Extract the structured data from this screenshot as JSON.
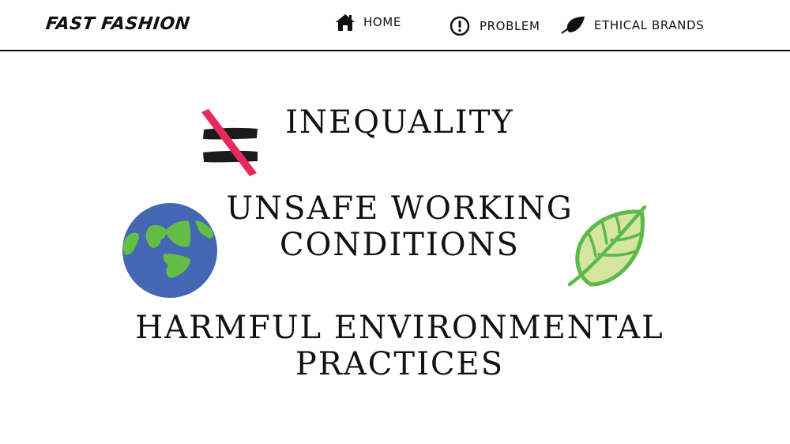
{
  "header": {
    "logo": "FAST FASHION",
    "nav": [
      {
        "label": "HOME",
        "icon": "home-icon"
      },
      {
        "label": "PROBLEM",
        "icon": "exclamation-circle-icon"
      },
      {
        "label": "ETHICAL BRANDS",
        "icon": "leaf-icon"
      }
    ]
  },
  "main": {
    "items": [
      {
        "lines": [
          "INEQUALITY"
        ]
      },
      {
        "lines": [
          "UNSAFE WORKING",
          "CONDITIONS"
        ]
      },
      {
        "lines": [
          "HARMFUL ENVIRONMENTAL",
          "PRACTICES"
        ]
      }
    ],
    "decor": {
      "not_equal_icon": "not-equal-icon",
      "globe_icon": "earth-globe-icon",
      "leaf_icon": "green-leaf-icon"
    }
  },
  "colors": {
    "text": "#111111",
    "accent_red": "#e8285a",
    "globe_blue": "#4466b3",
    "globe_green": "#63be46",
    "leaf_green": "#5cb94a",
    "leaf_fill": "#d4e6a0"
  }
}
